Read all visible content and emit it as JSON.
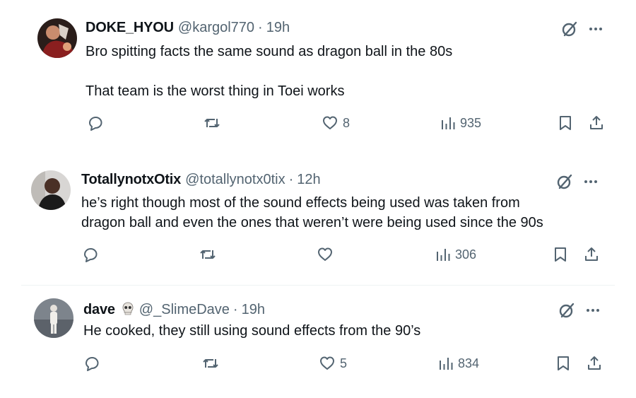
{
  "tweets": [
    {
      "name": "DOKE_HYOU",
      "handle": "@kargol770",
      "separator": "·",
      "time": "19h",
      "text": [
        "Bro spitting facts the same sound as dragon ball in the 80s",
        "",
        "That team is the worst thing in Toei works"
      ],
      "likes": "8",
      "views": "935"
    },
    {
      "name": "TotallynotxOtix",
      "handle": "@totallynotx0tix",
      "separator": "·",
      "time": "12h",
      "text": [
        "he’s right though most of the sound effects being used was taken from",
        "dragon ball and even the ones that weren’t were being used since the 90s"
      ],
      "likes": "",
      "views": "306"
    },
    {
      "name": "dave",
      "handle": "@_SlimeDave",
      "separator": "·",
      "time": "19h",
      "text": [
        "He cooked, they still using sound effects from the 90’s"
      ],
      "likes": "5",
      "views": "834"
    }
  ],
  "icons": {
    "reply": "reply-icon",
    "retweet": "retweet-icon",
    "like": "heart-icon",
    "views": "views-icon",
    "bookmark": "bookmark-icon",
    "share": "share-icon",
    "grok": "grok-icon",
    "more": "more-icon"
  },
  "colors": {
    "text": "#0f1419",
    "secondary": "#536471",
    "divider": "#eff3f4"
  }
}
